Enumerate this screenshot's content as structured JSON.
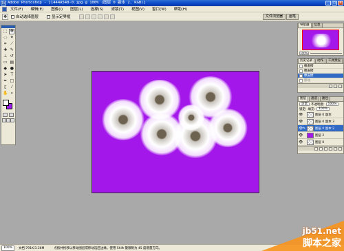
{
  "window": {
    "title": "Adobe Photoshop - [1444A548-0.jpg @ 100% (图层 0 副本 2, RGB)]",
    "controls": [
      "_",
      "□",
      "×"
    ]
  },
  "menu": [
    "文件(F)",
    "编辑(E)",
    "图像(I)",
    "图层(L)",
    "选择(S)",
    "滤镜(T)",
    "视图(V)",
    "窗口(W)",
    "帮助(H)"
  ],
  "options": {
    "auto_select_label": "自动选择图层",
    "show_bounds_label": "显示定界框",
    "palette_tabs": [
      "文件浏览器",
      "画笔"
    ]
  },
  "navigator": {
    "tabs": [
      "导航器",
      "信息"
    ],
    "zoom": "100%"
  },
  "history": {
    "tabs": [
      "历史记录",
      "动作",
      "工具预设"
    ],
    "items": [
      "橡皮擦",
      "橡皮擦",
      "橡皮擦",
      "移动"
    ],
    "selected_index": 2
  },
  "layers": {
    "tabs": [
      "图层",
      "通道",
      "路径"
    ],
    "blend_mode": "正常",
    "opacity_label": "不透明度:",
    "opacity_value": "100%",
    "lock_label": "锁定:",
    "fill_label": "填充:",
    "fill_value": "100%",
    "rows": [
      {
        "name": "图层 0 副本",
        "thumb": "checker",
        "selected": false
      },
      {
        "name": "图层 0 副本 3",
        "thumb": "checker",
        "selected": false
      },
      {
        "name": "图层 0 副本 2",
        "thumb": "checker",
        "selected": true
      },
      {
        "name": "图层 2",
        "thumb": "purple",
        "selected": false
      },
      {
        "name": "图层 0",
        "thumb": "checker",
        "selected": false
      }
    ]
  },
  "canvas": {
    "background_color": "#a417ea"
  },
  "status": {
    "zoom": "100%",
    "doc_size": "文档:791K/3.36M",
    "hint": "点按并拖移以移动图层或移动选区边缘。使用 Shift 键限制为 45 度增量方向。"
  },
  "watermark": {
    "line1": "jb51.net",
    "line2": "脚本之家"
  },
  "colors": {
    "accent": "#316ac5",
    "title_blue": "#0a46c4",
    "canvas_purple": "#a417ea",
    "watermark_orange": "#f7941d"
  }
}
